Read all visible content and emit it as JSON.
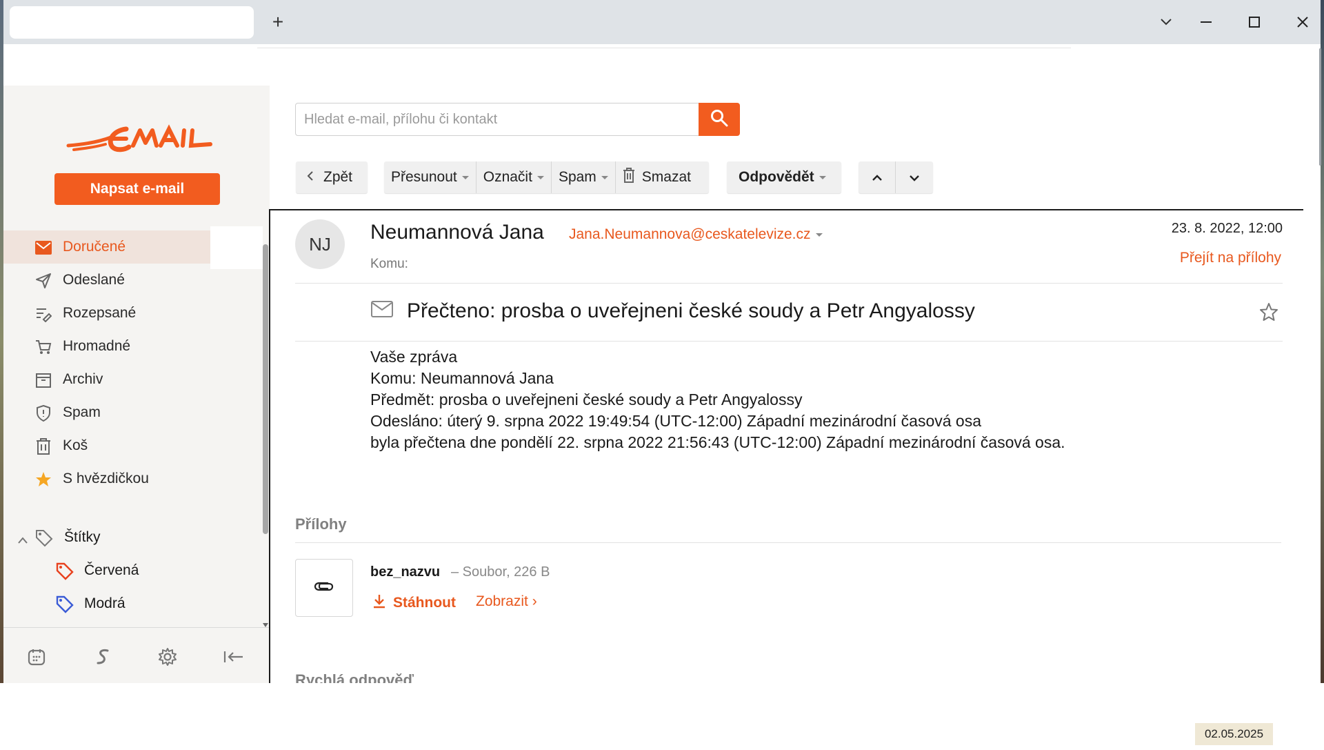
{
  "browser": {
    "new_tab": "+"
  },
  "sidebar": {
    "compose_label": "Napsat e-mail",
    "folders": [
      {
        "label": "Doručené",
        "icon": "envelope-icon",
        "active": true
      },
      {
        "label": "Odeslané",
        "icon": "send-icon"
      },
      {
        "label": "Rozepsané",
        "icon": "draft-icon"
      },
      {
        "label": "Hromadné",
        "icon": "cart-icon"
      },
      {
        "label": "Archiv",
        "icon": "archive-icon"
      },
      {
        "label": "Spam",
        "icon": "shield-icon"
      },
      {
        "label": "Koš",
        "icon": "trash-icon"
      },
      {
        "label": "S hvězdičkou",
        "icon": "star-icon"
      }
    ],
    "labels_title": "Štítky",
    "labels": [
      {
        "label": "Červená",
        "color": "#e8411e"
      },
      {
        "label": "Modrá",
        "color": "#3a5bd6"
      }
    ],
    "bottom_icons": [
      "calendar-icon",
      "s-logo-icon",
      "gear-icon",
      "collapse-icon"
    ]
  },
  "search": {
    "placeholder": "Hledat e-mail, přílohu či kontakt"
  },
  "toolbar": {
    "back": "Zpět",
    "move": "Přesunout",
    "mark": "Označit",
    "spam": "Spam",
    "delete": "Smazat",
    "reply": "Odpovědět"
  },
  "message": {
    "avatar_initials": "NJ",
    "sender_name": "Neumannová Jana",
    "sender_email": "Jana.Neumannova@ceskatelevize.cz",
    "to_label": "Komu:",
    "date": "23. 8. 2022, 12:00",
    "goto_attachments": "Přejít na přílohy",
    "subject": "Přečteno: prosba o uveřejneni české soudy a Petr Angyalossy",
    "body": [
      "Vaše zpráva",
      "",
      "Komu: Neumannová Jana",
      "Předmět: prosba o uveřejneni české soudy a Petr Angyalossy",
      "Odesláno: úterý 9. srpna 2022 19:49:54 (UTC-12:00) Západní mezinárodní časová osa",
      "",
      "byla přečtena dne pondělí 22. srpna 2022 21:56:43 (UTC-12:00) Západní mezinárodní časová osa."
    ],
    "attachments_title": "Přílohy",
    "attachment": {
      "name": "bez_nazvu",
      "meta": "– Soubor, 226 B",
      "download": "Stáhnout",
      "view": "Zobrazit ›"
    },
    "quick_reply_title": "Rychlá odpověď"
  },
  "taskbar": {
    "date": "02.05.2025"
  },
  "colors": {
    "accent": "#f25c1f",
    "link": "#e8581e"
  }
}
